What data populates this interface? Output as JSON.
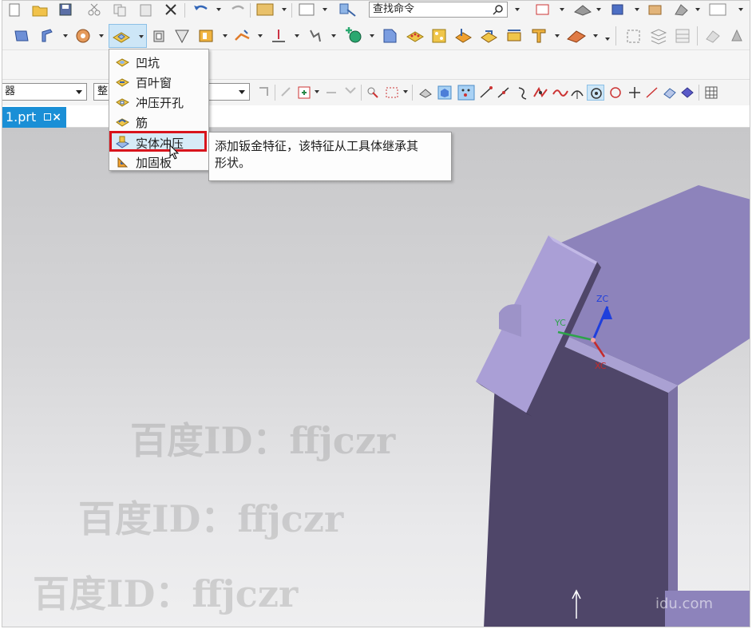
{
  "toolbar": {
    "search_placeholder": "查找命令",
    "combo_left_value": "器",
    "combo_mid_value": "整"
  },
  "tabs": [
    {
      "label": "1.prt"
    }
  ],
  "dropdown_menu": {
    "items": [
      {
        "label": "凹坑",
        "icon": "dimple-icon"
      },
      {
        "label": "百叶窗",
        "icon": "louver-icon"
      },
      {
        "label": "冲压开孔",
        "icon": "drawn-cutout-icon"
      },
      {
        "label": "筋",
        "icon": "bead-icon"
      },
      {
        "label": "实体冲压",
        "icon": "solid-punch-icon",
        "highlighted": true
      },
      {
        "label": "加固板",
        "icon": "gusset-icon"
      }
    ]
  },
  "tooltip": {
    "text_line1": "添加钣金特征，该特征从工具体继承其",
    "text_line2": "形状。"
  },
  "axes": {
    "zc": "ZC",
    "yc": "YC",
    "xc": "XC"
  },
  "watermarks": [
    {
      "text": "百度ID：ffjczr"
    },
    {
      "text": "百度ID：ffjczr"
    },
    {
      "text": "百度ID：ffjczr"
    }
  ],
  "corner_watermark": "idu.com",
  "colors": {
    "tab_active": "#1a8fd6",
    "highlight_border": "#d8141c",
    "part_face_front": "#4f4669",
    "part_face_top": "#8f85bd",
    "part_face_light": "#a69ad0"
  }
}
